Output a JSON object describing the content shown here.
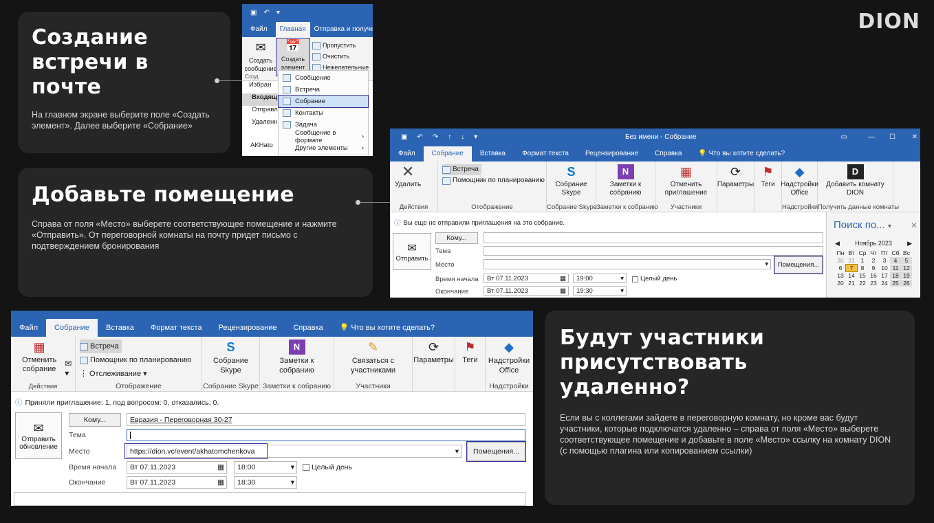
{
  "brand": {
    "logo": "DION"
  },
  "step1": {
    "title": "Создание встречи в почте",
    "text": "На главном экране выберите поле «Создать элемент». Далее выберите «Собрание»"
  },
  "step2": {
    "title": "Добавьте помещение",
    "text": "Справа от поля «Место» выберете соответствующее помещение и нажмите «Отправить». От переговорной комнаты на почту придет письмо с подтверждением бронирования"
  },
  "step3": {
    "title": "Будут участники присутствовать удаленно?",
    "text": "Если вы с коллегами зайдете в переговорную комнату, но кроме вас будут участники, которые подключатся удаленно – справа от поля «Место» выберете соответствующее помещение и добавьте в поле «Место» ссылку на комнату DION (с помощью плагина или копированием ссылки)"
  },
  "shot1": {
    "tabs": [
      "Файл",
      "Главная",
      "Отправка и получение"
    ],
    "create_message": "Создать сообщение",
    "create_item": "Создать элемент",
    "side_actions": [
      "Пропустить",
      "Очистить",
      "Нежелательные"
    ],
    "group_label": "Созд",
    "folders": [
      "Избран",
      "Входящ",
      "Отправле",
      "Удаленн",
      "AKHato"
    ],
    "menu": [
      "Сообщение",
      "Встреча",
      "Собрание",
      "Контакты",
      "Задача",
      "Сообщение в формате",
      "Другие элементы"
    ]
  },
  "shot2": {
    "window_title": "Без имени - Собрание",
    "tabs": [
      "Файл",
      "Собрание",
      "Вставка",
      "Формат текста",
      "Рецензирование",
      "Справка",
      "Что вы хотите сделать?"
    ],
    "delete": "Удалить",
    "meeting": "Встреча",
    "planner": "Помощник по планированию",
    "skype": "Собрание Skype",
    "notes": "Заметки к собранию",
    "cancel_invite": "Отменить приглашение",
    "params": "Параметры",
    "tags": "Теги",
    "addins": "Надстройки Office",
    "add_room": "Добавить комнату DION",
    "groups": [
      "Действия",
      "Отображение",
      "Собрание Skype",
      "Заметки к собранию",
      "Участники",
      "Надстройки",
      "Получить данные комнаты"
    ],
    "info": "Вы еще не отправили приглашения на это собрание.",
    "to_btn": "Кому...",
    "subject_label": "Тема",
    "location_label": "Место",
    "rooms_btn": "Помещения...",
    "send": "Отправить",
    "start_label": "Время начала",
    "end_label": "Окончание",
    "start_date": "Вт 07.11.2023",
    "start_time": "19:00",
    "end_date": "Вт 07.11.2023",
    "end_time": "19:30",
    "all_day": "Целый день",
    "search": "Поиск по...",
    "calendar_month": "Ноябрь 2023",
    "calendar_days": [
      "Пн",
      "Вт",
      "Ср",
      "Чт",
      "Пт",
      "Сб",
      "Вс"
    ],
    "calendar_rows": [
      [
        "30",
        "31",
        "1",
        "2",
        "3",
        "4",
        "5"
      ],
      [
        "6",
        "7",
        "8",
        "9",
        "10",
        "11",
        "12"
      ],
      [
        "13",
        "14",
        "15",
        "16",
        "17",
        "18",
        "19"
      ],
      [
        "20",
        "21",
        "22",
        "23",
        "24",
        "25",
        "26"
      ]
    ]
  },
  "shot3": {
    "tabs": [
      "Файл",
      "Собрание",
      "Вставка",
      "Формат текста",
      "Рецензирование",
      "Справка",
      "Что вы хотите сделать?"
    ],
    "cancel_meeting": "Отменить собрание",
    "meeting": "Встреча",
    "planner": "Помощник по планированию",
    "tracking": "Отслеживание",
    "skype": "Собрание Skype",
    "notes": "Заметки к собранию",
    "contact": "Связаться с участниками",
    "params": "Параметры",
    "tags": "Теги",
    "addins": "Надстройки Office",
    "groups": [
      "Действия",
      "Отображение",
      "Собрание Skype",
      "Заметки к собранию",
      "Участники",
      "Надстройки"
    ],
    "info": "Приняли приглашение: 1, под вопросом: 0, отказались: 0.",
    "to_btn": "Кому...",
    "to_value": "Евразия - Переговорная 30-27",
    "subject_label": "Тема",
    "location_label": "Место",
    "location_value": "https://dion.vc/event/akhatomchenkova",
    "rooms_btn": "Помещения...",
    "send": "Отправить обновление",
    "start_label": "Время начала",
    "end_label": "Окончание",
    "start_date": "Вт 07.11.2023",
    "start_time": "18:00",
    "end_date": "Вт 07.11.2023",
    "end_time": "18:30",
    "all_day": "Целый день"
  },
  "colors": {
    "bg": "#141414",
    "card": "#262626",
    "outlook_blue": "#2b64b2",
    "highlight": "#3a2fa0"
  }
}
